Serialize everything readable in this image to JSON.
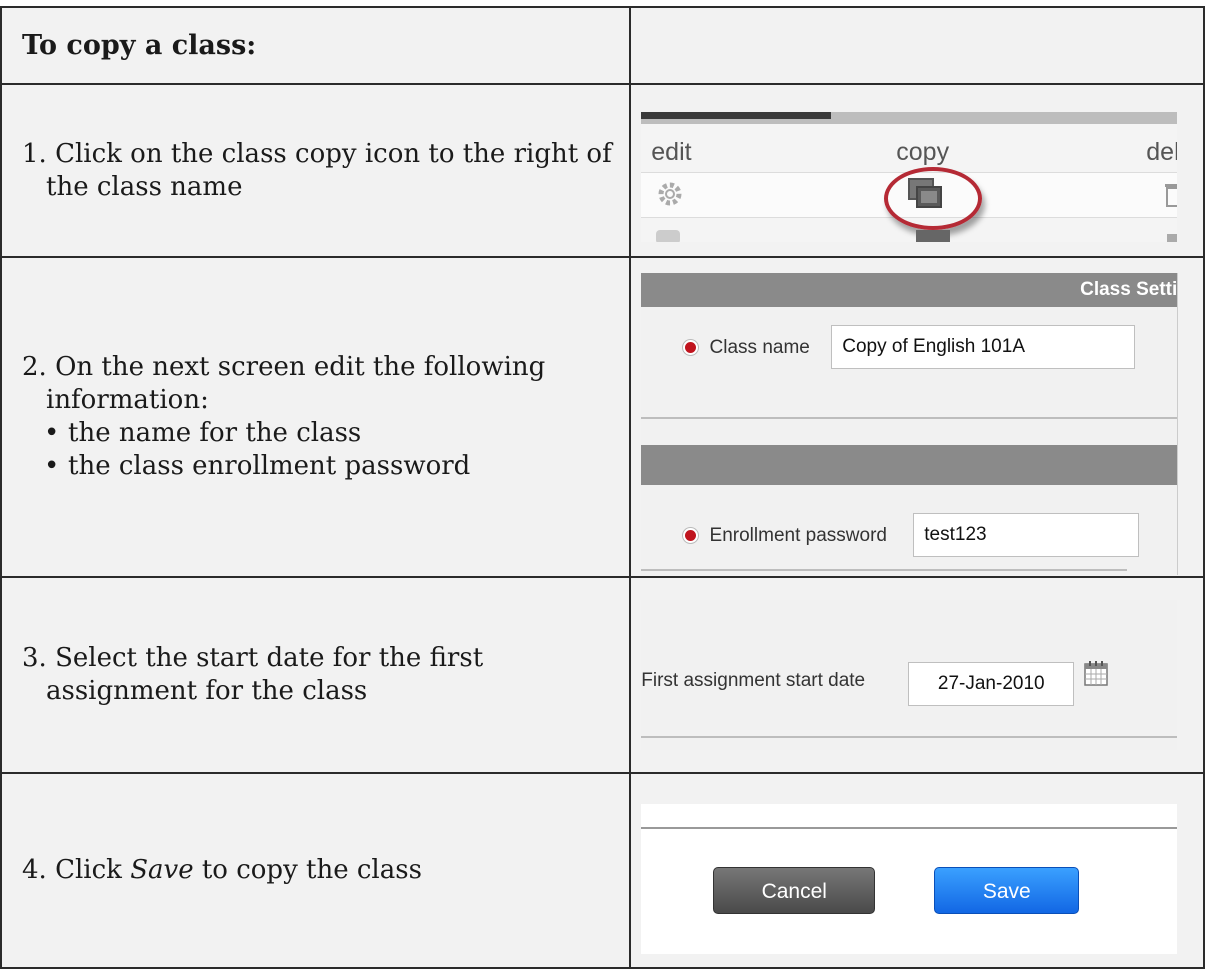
{
  "heading": "To copy a class:",
  "steps": {
    "s1": {
      "text": "1. Click on the class copy icon to the right of the class name"
    },
    "s2": {
      "text": "2. On the next screen edit the following information:",
      "bullets": [
        "the name for the class",
        "the class enrollment password"
      ]
    },
    "s3": {
      "text": "3. Select the start date for the first assignment for the class"
    },
    "s4": {
      "pre": "4. Click ",
      "em": "Save",
      "post": " to copy the class"
    }
  },
  "img1": {
    "col_edit": "edit",
    "col_copy": "copy",
    "col_delete": "dele",
    "icons": [
      "gear-icon",
      "copy-icon",
      "trash-icon"
    ],
    "highlight_color": "#b52a35"
  },
  "img2": {
    "section_title": "Class Setti",
    "class_name_label": "Class name",
    "class_name_value": "Copy of English 101A",
    "password_label": "Enrollment password",
    "password_value": "test123"
  },
  "img3": {
    "date_label": "First assignment start date",
    "date_value": "27-Jan-2010",
    "icon": "calendar-icon"
  },
  "img4": {
    "cancel_label": "Cancel",
    "save_label": "Save",
    "save_color": "#1a73e8"
  }
}
